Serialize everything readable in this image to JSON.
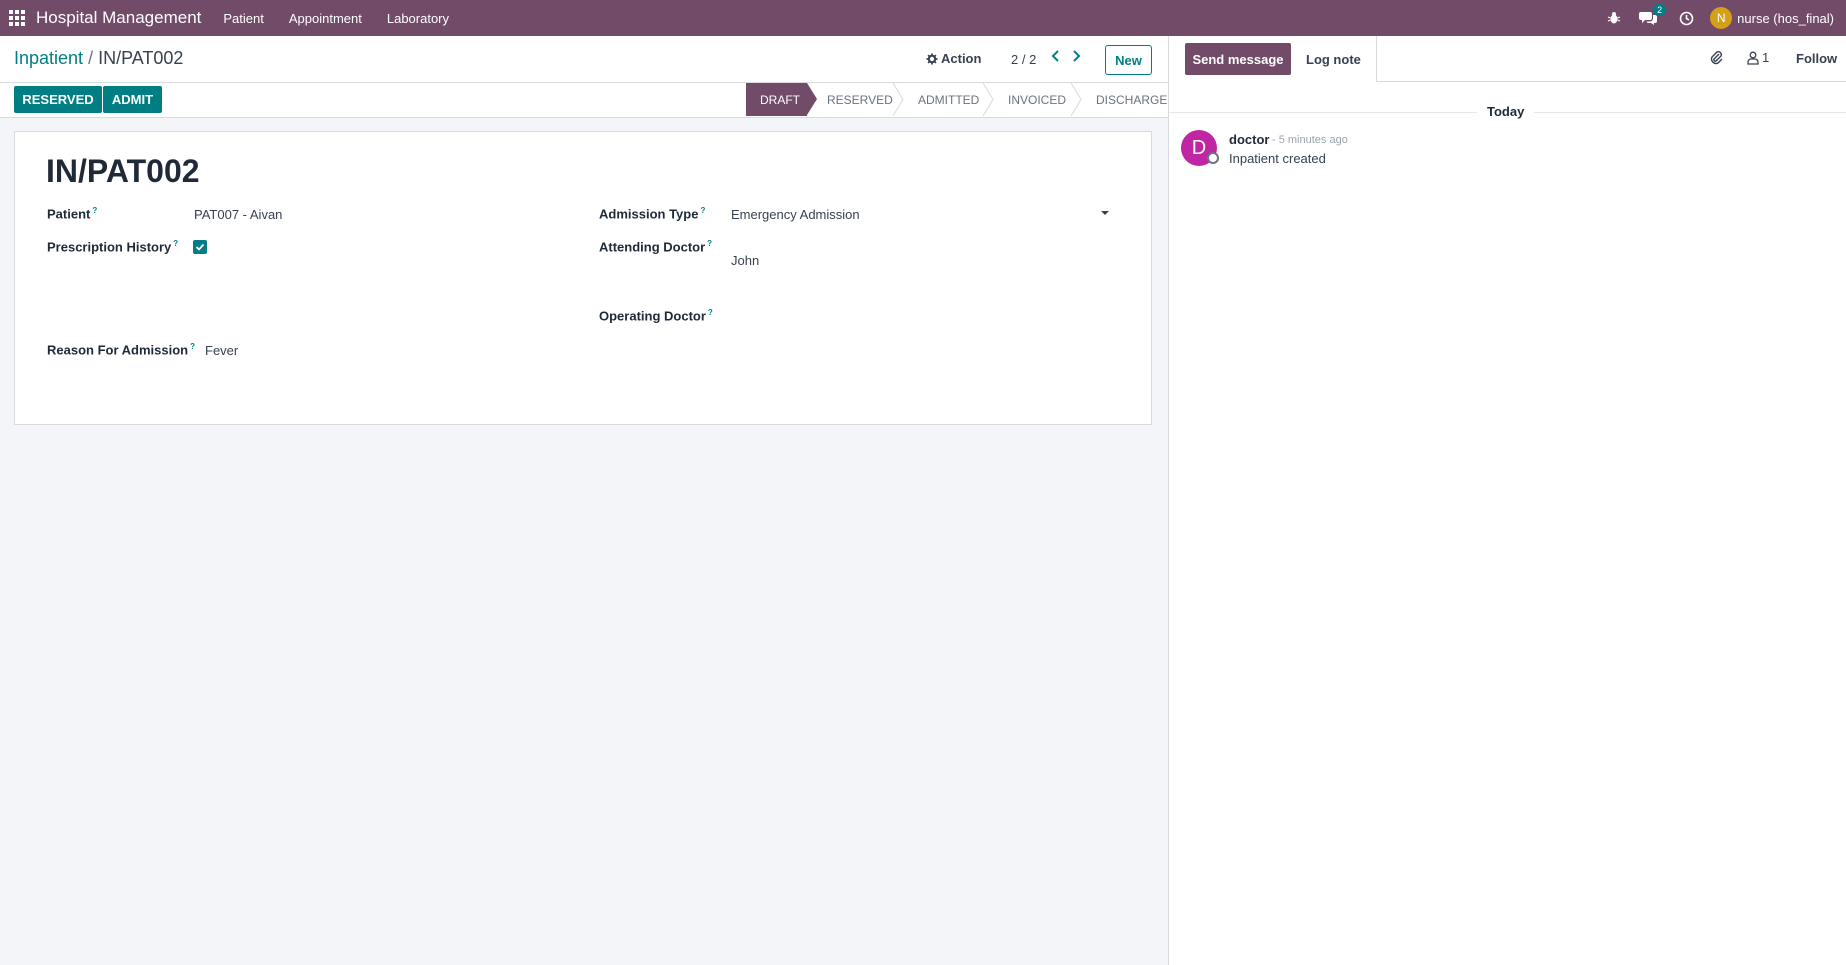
{
  "navbar": {
    "brand": "Hospital Management",
    "menus": [
      "Patient",
      "Appointment",
      "Laboratory"
    ],
    "message_count": "2",
    "user_initial": "N",
    "user_name": "nurse (hos_final)"
  },
  "control": {
    "breadcrumb_parent": "Inpatient",
    "breadcrumb_separator": "/",
    "breadcrumb_current": "IN/PAT002",
    "action_label": "Action",
    "pager": "2 / 2",
    "new_label": "New"
  },
  "statusbar": {
    "buttons": [
      "RESERVED",
      "ADMIT"
    ],
    "stages": [
      "DRAFT",
      "RESERVED",
      "ADMITTED",
      "INVOICED",
      "DISCHARGE"
    ],
    "active_stage": "DRAFT"
  },
  "form": {
    "title": "IN/PAT002",
    "patient_label": "Patient",
    "patient_value": "PAT007 - Aivan",
    "prescription_label": "Prescription History",
    "prescription_checked": true,
    "admission_type_label": "Admission Type",
    "admission_type_value": "Emergency Admission",
    "attending_doctor_label": "Attending Doctor",
    "attending_doctor_value": "John",
    "operating_doctor_label": "Operating Doctor",
    "reason_label": "Reason For Admission",
    "reason_value": "Fever",
    "help_mark": "?"
  },
  "chatter": {
    "send_message": "Send message",
    "log_note": "Log note",
    "followers_count": "1",
    "follow": "Follow",
    "day_label": "Today",
    "messages": [
      {
        "avatar_initial": "D",
        "author": "doctor",
        "time": "- 5 minutes ago",
        "body": "Inpatient created"
      }
    ]
  },
  "colors": {
    "brand": "#714B67",
    "accent": "#017e84"
  }
}
